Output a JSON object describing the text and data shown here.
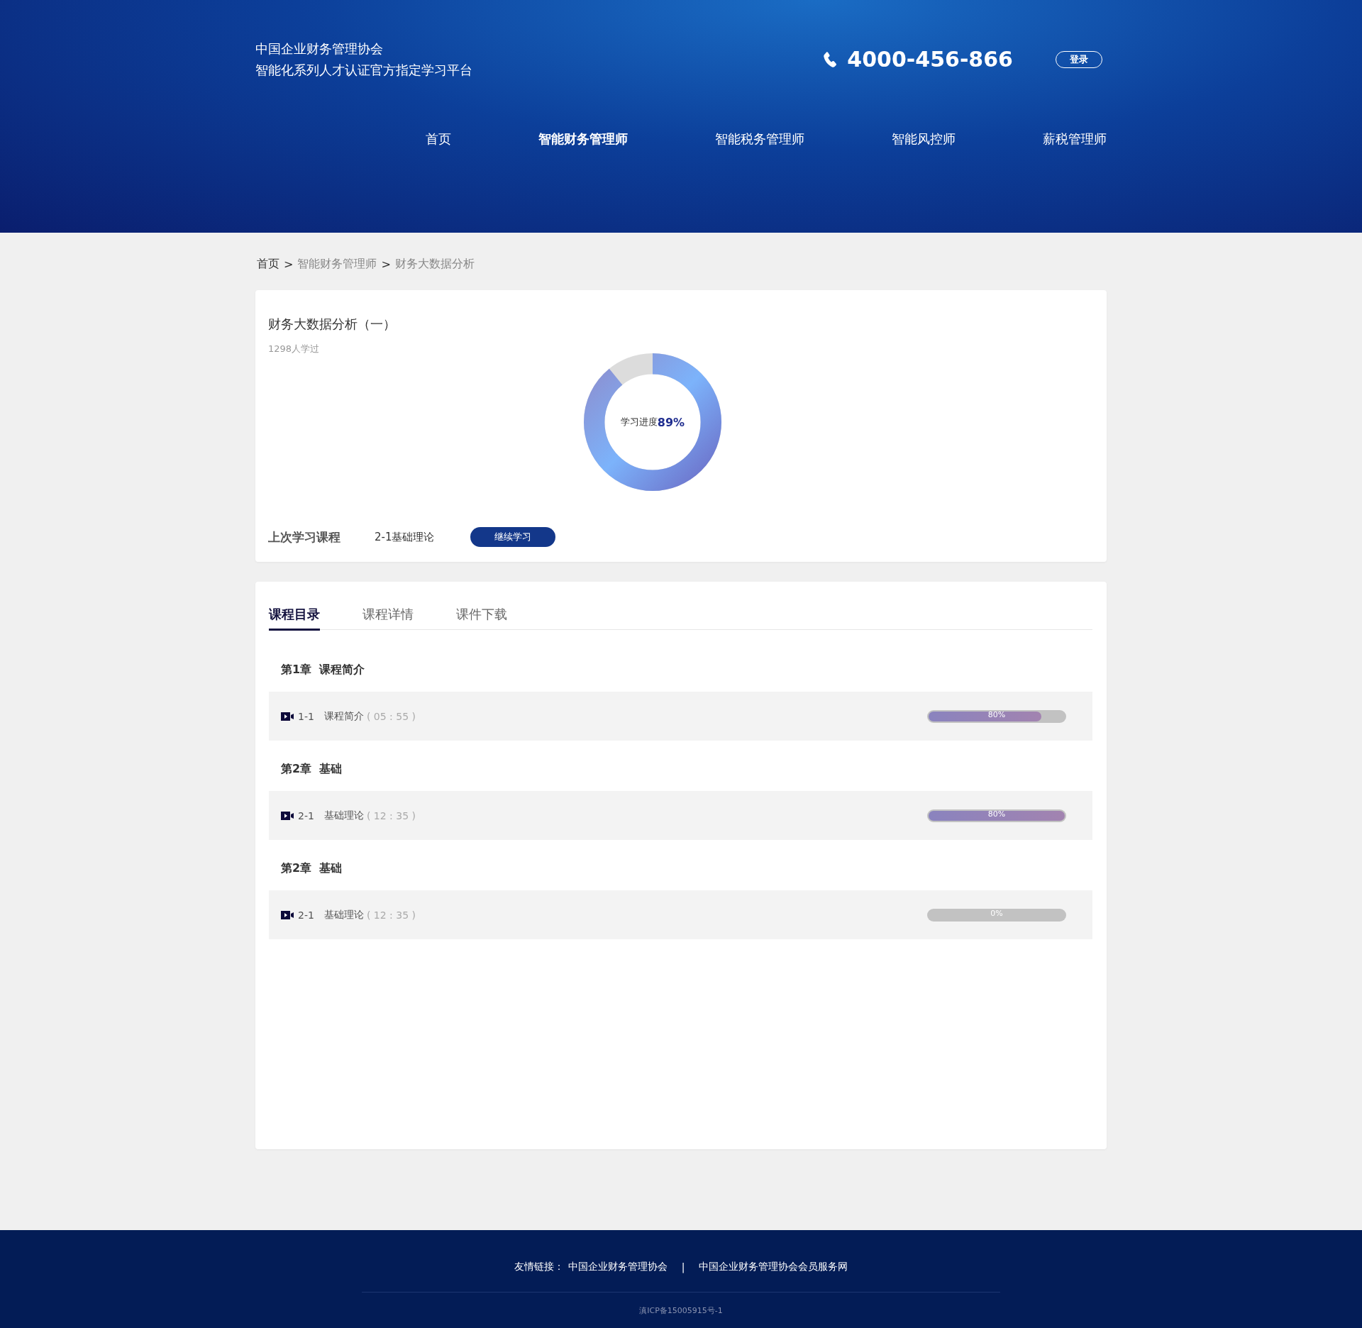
{
  "header": {
    "org_lines": [
      "中国企业财务管理协会",
      "智能化系列人才认证官方指定学习平台"
    ],
    "phone": "4000-456-866",
    "login_button": "登录"
  },
  "nav": [
    {
      "label": "首页",
      "selected": false
    },
    {
      "label": "智能财务管理师",
      "selected": true
    },
    {
      "label": "智能税务管理师",
      "selected": false
    },
    {
      "label": "智能风控师",
      "selected": false
    },
    {
      "label": "薪税管理师",
      "selected": false
    }
  ],
  "breadcrumb": {
    "items": [
      "首页",
      "智能财务管理师",
      "财务大数据分析"
    ],
    "separator": ">"
  },
  "course": {
    "title": "财务大数据分析（一）",
    "learners": "1298人学过",
    "progress": {
      "label": "学习进度",
      "value": "89%",
      "level": 0.89
    },
    "last_lesson": {
      "label": "上次学习课程",
      "lesson": "2-1基础理论",
      "button": "继续学习"
    }
  },
  "tabs": [
    {
      "label": "课程目录",
      "selected": true
    },
    {
      "label": "课程详情",
      "selected": false
    },
    {
      "label": "课件下载",
      "selected": false
    }
  ],
  "chapters": [
    {
      "title": "第1章  课程简介",
      "lessons": [
        {
          "number": "1-1",
          "title": "课程简介",
          "duration": "( 05 : 55 )",
          "progress_label": "80%",
          "level": 0.83
        }
      ]
    },
    {
      "title": "第2章  基础",
      "lessons": [
        {
          "number": "2-1",
          "title": "基础理论",
          "duration": "( 12 : 35 )",
          "progress_label": "80%",
          "level": 1
        }
      ]
    },
    {
      "title": "第2章  基础",
      "lessons": [
        {
          "number": "2-1",
          "title": "基础理论",
          "duration": "( 12 : 35 )",
          "progress_label": "0%",
          "level": 0
        }
      ]
    }
  ],
  "footer": {
    "links_label": "友情链接：",
    "links": [
      "中国企业财务管理协会",
      "中国企业财务管理协会会员服务网"
    ],
    "separator": "|",
    "icp": "滇ICP备15005915号-1"
  }
}
